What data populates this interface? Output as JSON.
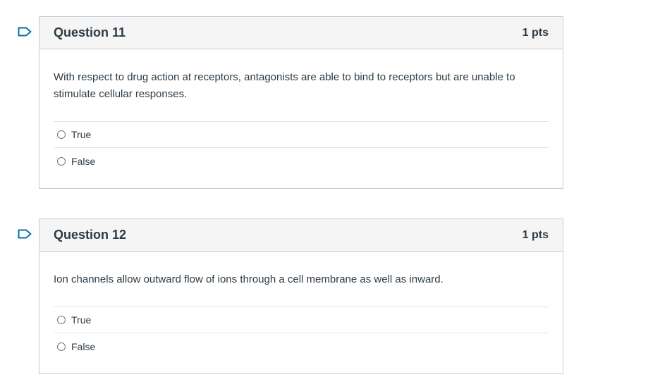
{
  "questions": [
    {
      "title": "Question 11",
      "points": "1 pts",
      "text": "With respect to drug action at receptors, antagonists are able to bind to receptors but are unable to stimulate cellular responses.",
      "answers": [
        {
          "label": "True"
        },
        {
          "label": "False"
        }
      ]
    },
    {
      "title": "Question 12",
      "points": "1 pts",
      "text": "Ion channels allow outward flow of ions through a cell membrane as well as inward.",
      "answers": [
        {
          "label": "True"
        },
        {
          "label": "False"
        }
      ]
    }
  ],
  "colors": {
    "header_bg": "#f5f5f5",
    "border": "#c7cdd1",
    "text": "#2d3b45",
    "flag": "#0770a3"
  },
  "icons": {
    "flag": "flag-question-icon",
    "radio": "radio-button-icon"
  }
}
